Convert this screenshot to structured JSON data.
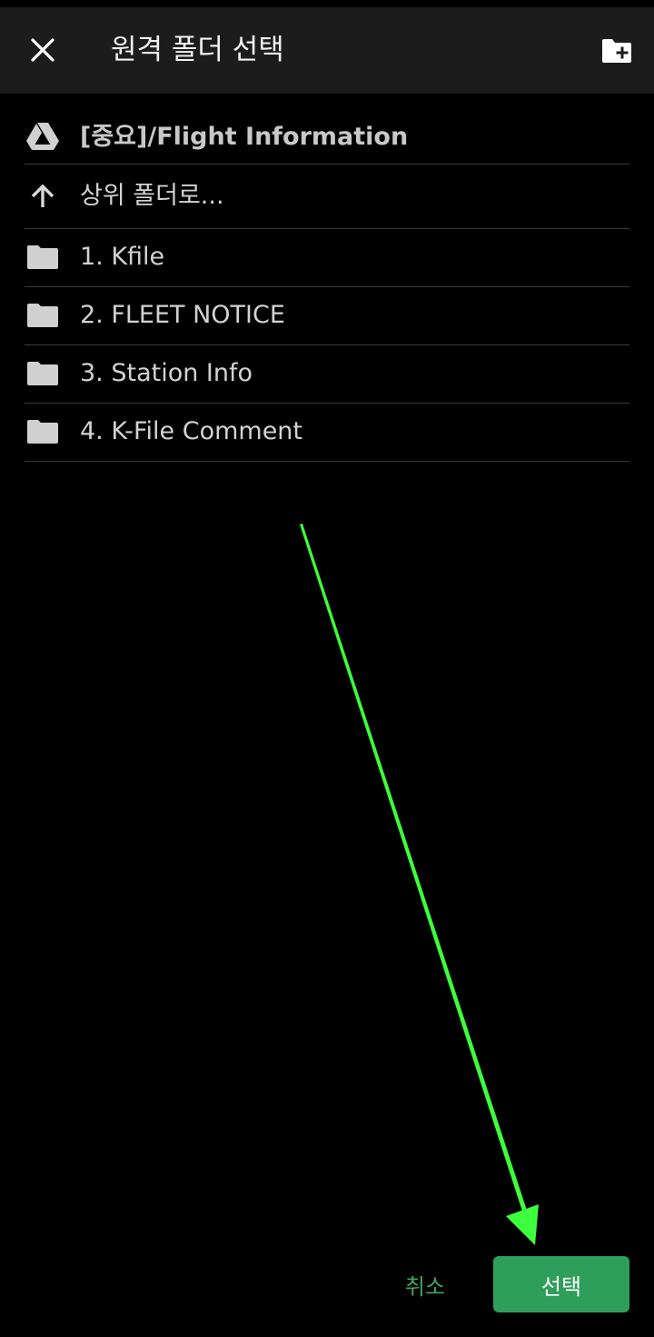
{
  "app_bar": {
    "title": "원격 폴더 선택",
    "close_icon": "close-icon",
    "new_folder_icon": "create-new-folder-icon",
    "background": "#1c1c1c"
  },
  "list": {
    "current_path": {
      "icon": "google-drive-icon",
      "label": "[중요]/Flight Information"
    },
    "parent": {
      "icon": "arrow-up-icon",
      "label": "상위 폴더로..."
    },
    "folders": [
      {
        "icon": "folder-icon",
        "label": "1. Kfile"
      },
      {
        "icon": "folder-icon",
        "label": "2. FLEET NOTICE"
      },
      {
        "icon": "folder-icon",
        "label": "3. Station Info"
      },
      {
        "icon": "folder-icon",
        "label": "4. K-File Comment"
      }
    ]
  },
  "actions": {
    "cancel_label": "취소",
    "select_label": "선택",
    "accent_color": "#2f9e5a"
  },
  "annotation": {
    "arrow_color": "#3dff3d"
  }
}
